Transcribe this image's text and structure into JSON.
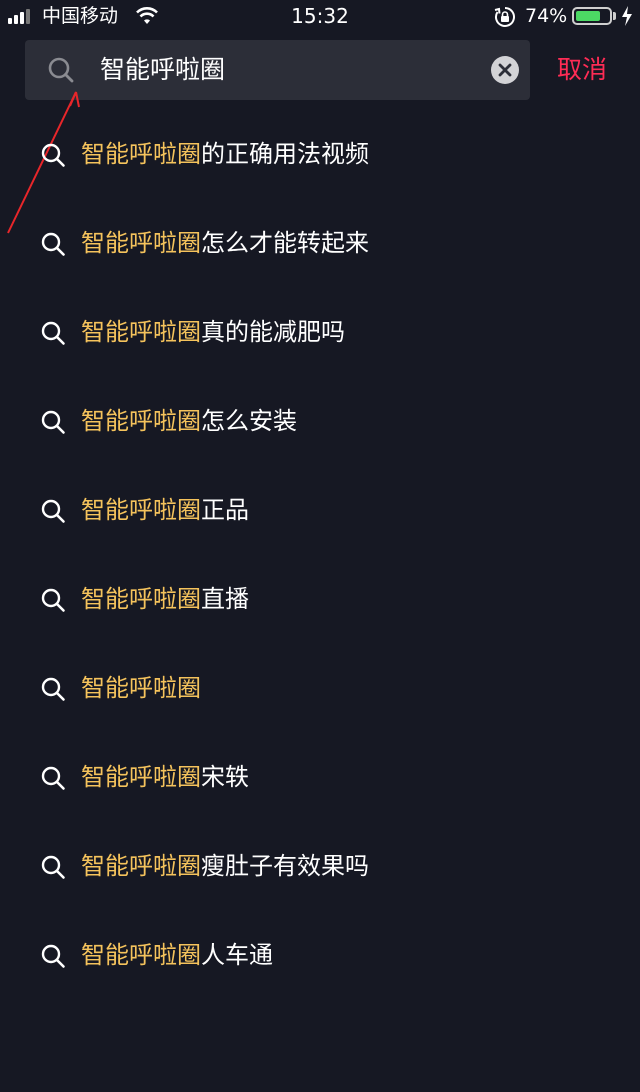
{
  "status_bar": {
    "carrier": "中国移动",
    "time": "15:32",
    "battery_percent": "74%",
    "battery_level": 0.74
  },
  "search": {
    "query": "智能呼啦圈",
    "cancel_label": "取消"
  },
  "suggestions": [
    {
      "highlight": "智能呼啦圈",
      "rest": "的正确用法视频"
    },
    {
      "highlight": "智能呼啦圈",
      "rest": "怎么才能转起来"
    },
    {
      "highlight": "智能呼啦圈",
      "rest": "真的能减肥吗"
    },
    {
      "highlight": "智能呼啦圈",
      "rest": "怎么安装"
    },
    {
      "highlight": "智能呼啦圈",
      "rest": "正品"
    },
    {
      "highlight": "智能呼啦圈",
      "rest": "直播"
    },
    {
      "highlight": "智能呼啦圈",
      "rest": ""
    },
    {
      "highlight": "智能呼啦圈",
      "rest": "宋轶"
    },
    {
      "highlight": "智能呼啦圈",
      "rest": "瘦肚子有效果吗"
    },
    {
      "highlight": "智能呼啦圈",
      "rest": "人车通"
    }
  ],
  "colors": {
    "background": "#161823",
    "search_box": "#2c2e38",
    "highlight": "#f5c35c",
    "cancel": "#fe2c55",
    "annotation": "#e8262a"
  }
}
